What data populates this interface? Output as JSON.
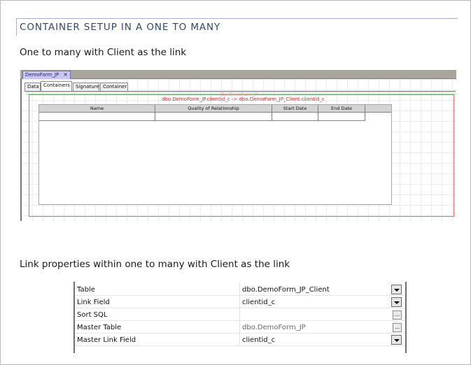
{
  "heading": "CONTAINER SETUP IN A ONE TO MANY",
  "paragraph1": "One to many with Client as the link",
  "paragraph2": "Link properties within one to many with Client as the link",
  "designer": {
    "doc_tab": "DemoForm_JP",
    "doc_tab_close": "×",
    "tabs": [
      "Data",
      "Containers",
      "Signature",
      "Container"
    ],
    "active_tab": "Containers",
    "container_link": "dbo.DemoForm_JP.clientid_c -> dbo.DemoForm_JP_Client.clientid_c",
    "container_name": "dbo.DemoForm_JP",
    "columns": [
      "Name",
      "Quality of Relationship",
      "Start Date",
      "End Date"
    ]
  },
  "properties": {
    "rows": [
      {
        "label": "Table",
        "value": "dbo.DemoForm_JP_Client",
        "control": "dropdown",
        "muted": false
      },
      {
        "label": "Link Field",
        "value": "clientid_c",
        "control": "dropdown",
        "muted": false
      },
      {
        "label": "Sort SQL",
        "value": "",
        "control": "ellipsis",
        "muted": false
      },
      {
        "label": "Master Table",
        "value": "dbo.DemoForm_JP",
        "control": "ellipsis",
        "muted": true
      },
      {
        "label": "Master Link Field",
        "value": "clientid_c",
        "control": "dropdown",
        "muted": false
      }
    ],
    "ellipsis_glyph": "..."
  },
  "colors": {
    "heading_text": "#2f4a6c",
    "container_border": "#ea6a6a",
    "link_text": "#d23030",
    "doc_tab_bg": "#c9c6f2"
  }
}
